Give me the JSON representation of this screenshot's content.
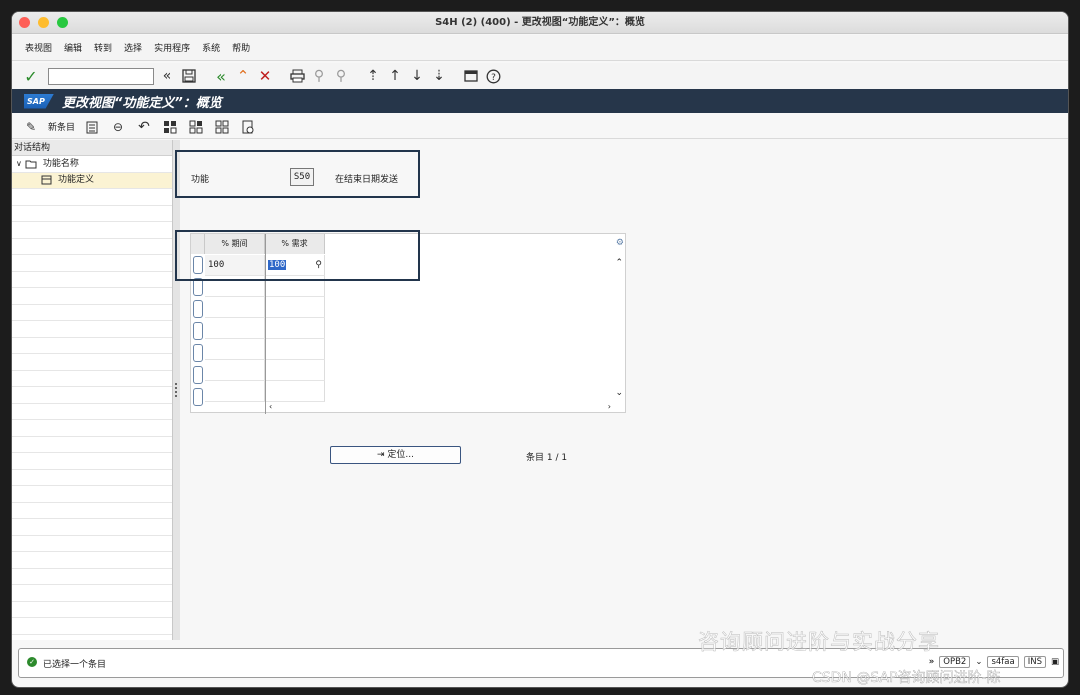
{
  "window": {
    "title": "S4H (2) (400) - 更改视图“功能定义”：概览"
  },
  "menu": [
    "表视图",
    "编辑",
    "转到",
    "选择",
    "实用程序",
    "系统",
    "帮助"
  ],
  "toolbar": {
    "command_value": ""
  },
  "header": {
    "logo": "SAP",
    "title": "更改视图“功能定义”：概览"
  },
  "app_toolbar": {
    "new_entries": "新条目"
  },
  "tree": {
    "heading": "对话结构",
    "root": "功能名称",
    "child": "功能定义"
  },
  "form": {
    "function_label": "功能",
    "function_value": "S50",
    "function_desc": "在结束日期发送"
  },
  "table": {
    "columns": [
      "% 期间",
      "% 需求"
    ],
    "rows": [
      [
        "100",
        "100"
      ]
    ]
  },
  "buttons": {
    "position": "定位..."
  },
  "entries": "条目 1 / 1",
  "status": {
    "message": "已选择一个条目",
    "transaction": "OPB2",
    "server": "s4faa",
    "mode": "INS"
  },
  "watermark": {
    "line1": "咨询顾问进阶与实战分享",
    "line2": "CSDN @SAP咨询顾问进阶-陈"
  },
  "colors": {
    "sap_bar": "#26364a",
    "highlight_box": "#22354c",
    "selected_row": "#fbf3d3"
  }
}
